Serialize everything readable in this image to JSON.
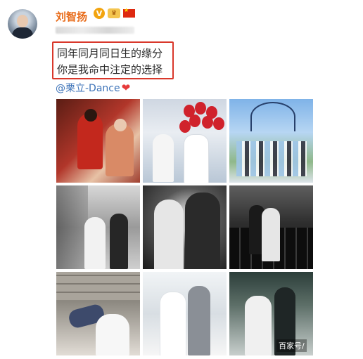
{
  "post": {
    "username": "刘智扬",
    "verified_badge": "V",
    "line1": "同年同月同日生的缘分",
    "line2": "你是我命中注定的选择",
    "mention": "@栗立-Dance",
    "heart_icon": "heart-icon"
  },
  "photos": [
    {
      "label": "wedding-photo-1"
    },
    {
      "label": "wedding-photo-2"
    },
    {
      "label": "wedding-photo-3"
    },
    {
      "label": "wedding-photo-4"
    },
    {
      "label": "wedding-photo-5"
    },
    {
      "label": "wedding-photo-6"
    },
    {
      "label": "wedding-photo-7"
    },
    {
      "label": "wedding-photo-8"
    },
    {
      "label": "wedding-photo-9"
    }
  ],
  "watermark": "百家号/"
}
